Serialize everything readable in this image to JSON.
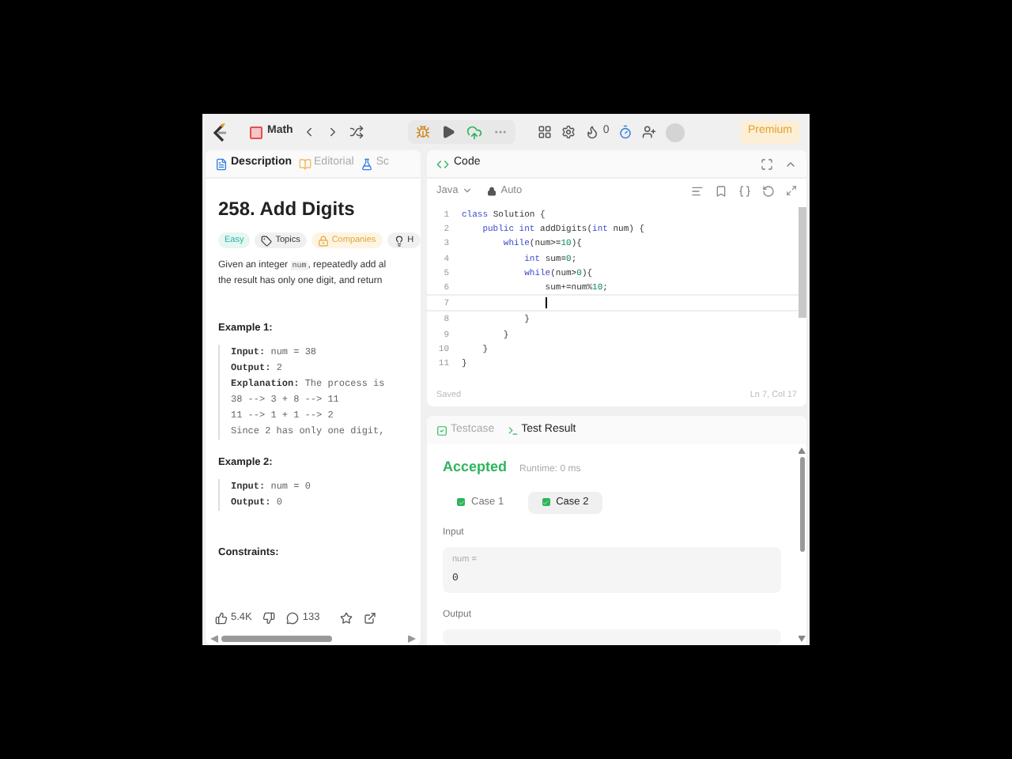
{
  "nav": {
    "problem_list": "Math",
    "coins": "0",
    "premium": "Premium"
  },
  "left_tabs": [
    {
      "label": "Description",
      "selected": true
    },
    {
      "label": "Editorial",
      "selected": false
    },
    {
      "label": "Sc",
      "selected": false
    }
  ],
  "problem": {
    "title": "258. Add Digits",
    "tags": [
      {
        "label": "Easy",
        "kind": "difficulty"
      },
      {
        "label": "Topics",
        "kind": "topics"
      },
      {
        "label": "Companies",
        "kind": "companies"
      },
      {
        "label": "H",
        "kind": "hint"
      }
    ],
    "description": [
      [
        {
          "kind": "text",
          "text": "Given an integer "
        },
        {
          "kind": "code",
          "text": "num"
        },
        {
          "kind": "text",
          "text": ", repeatedly add al"
        }
      ],
      [
        {
          "kind": "text",
          "text": "the result has only one digit, and return"
        }
      ]
    ],
    "examples": [
      {
        "title": "Example 1:",
        "lines": [
          {
            "label": "Input:",
            "value": "num = 38"
          },
          {
            "label": "Output:",
            "value": "2"
          },
          {
            "label": "Explanation:",
            "value": "The process is"
          },
          {
            "value": "38 --> 3 + 8 --> 11"
          },
          {
            "value": "11 --> 1 + 1 --> 2"
          },
          {
            "value": "Since 2 has only one digit,"
          }
        ]
      },
      {
        "title": "Example 2:",
        "lines": [
          {
            "label": "Input:",
            "value": "num = 0"
          },
          {
            "label": "Output:",
            "value": "0"
          }
        ]
      }
    ],
    "constraints_title": "Constraints:",
    "likes": "5.4K",
    "comments": "133"
  },
  "code_panel": {
    "title": "Code",
    "language": "Java",
    "mode": "Auto",
    "lines": [
      {
        "number": "1",
        "tokens": [
          {
            "kind": "kw",
            "text": "class"
          },
          {
            "kind": "plain",
            "text": " Solution {"
          }
        ]
      },
      {
        "number": "2",
        "tokens": [
          {
            "kind": "kw",
            "text": "    public int"
          },
          {
            "kind": "plain",
            "text": " addDigits("
          },
          {
            "kind": "kw",
            "text": "int"
          },
          {
            "kind": "plain",
            "text": " num) {"
          }
        ]
      },
      {
        "number": "3",
        "tokens": [
          {
            "kind": "kw",
            "text": "        while"
          },
          {
            "kind": "plain",
            "text": "(num>="
          },
          {
            "kind": "num",
            "text": "10"
          },
          {
            "kind": "plain",
            "text": "){"
          }
        ]
      },
      {
        "number": "4",
        "tokens": [
          {
            "kind": "kw",
            "text": "            int"
          },
          {
            "kind": "plain",
            "text": " sum="
          },
          {
            "kind": "num",
            "text": "0"
          },
          {
            "kind": "plain",
            "text": ";"
          }
        ]
      },
      {
        "number": "5",
        "tokens": [
          {
            "kind": "kw",
            "text": "            while"
          },
          {
            "kind": "plain",
            "text": "(num>"
          },
          {
            "kind": "num",
            "text": "0"
          },
          {
            "kind": "plain",
            "text": "){"
          }
        ]
      },
      {
        "number": "6",
        "tokens": [
          {
            "kind": "plain",
            "text": "                sum+=num%"
          },
          {
            "kind": "num",
            "text": "10"
          },
          {
            "kind": "plain",
            "text": ";"
          }
        ]
      },
      {
        "number": "7",
        "cursor": true
      },
      {
        "number": "8",
        "tokens": [
          {
            "kind": "plain",
            "text": "            }"
          }
        ]
      },
      {
        "number": "9",
        "tokens": [
          {
            "kind": "plain",
            "text": "        }"
          }
        ]
      },
      {
        "number": "10",
        "tokens": [
          {
            "kind": "plain",
            "text": "    }"
          }
        ]
      },
      {
        "number": "11",
        "tokens": [
          {
            "kind": "plain",
            "text": "}"
          }
        ]
      }
    ],
    "status": "Saved",
    "position": "Ln 7, Col 17"
  },
  "result_tabs": [
    {
      "label": "Testcase",
      "selected": false
    },
    {
      "label": "Test Result",
      "selected": true
    }
  ],
  "result": {
    "verdict": "Accepted",
    "runtime": "Runtime: 0 ms",
    "cases": [
      {
        "label": "Case 1",
        "selected": false,
        "passed": true
      },
      {
        "label": "Case 2",
        "selected": true,
        "passed": true
      }
    ],
    "input_label": "Input",
    "input_name": "num =",
    "input_value": "0",
    "output_label": "Output"
  }
}
